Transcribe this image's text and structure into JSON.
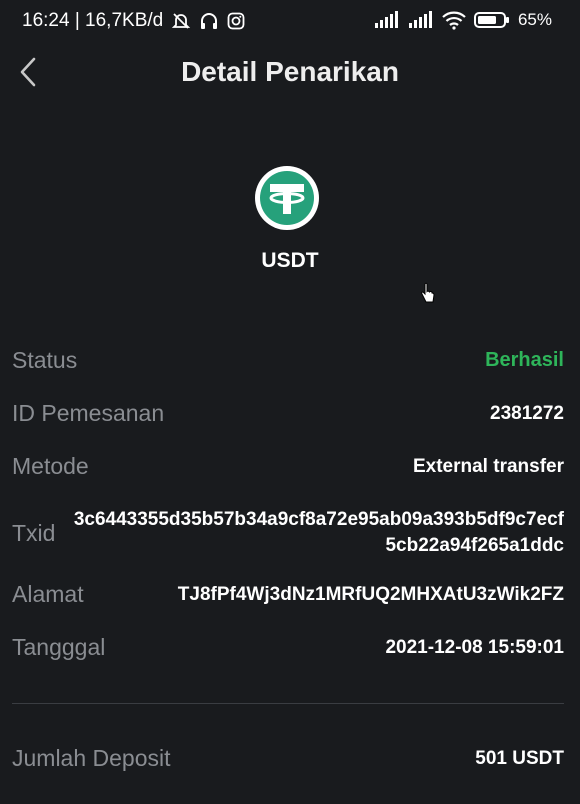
{
  "status_bar": {
    "time_info": "16:24 | 16,7KB/d",
    "battery_percent": "65%"
  },
  "header": {
    "title": "Detail Penarikan"
  },
  "coin": {
    "name": "USDT",
    "logo_color": "#26a17b"
  },
  "details": {
    "status": {
      "label": "Status",
      "value": "Berhasil",
      "color": "#2eb55a"
    },
    "order_id": {
      "label": "ID Pemesanan",
      "value": "2381272"
    },
    "method": {
      "label": "Metode",
      "value": "External transfer"
    },
    "txid": {
      "label": "Txid",
      "value": "3c6443355d35b57b34a9cf8a72e95ab09a393b5df9c7ecf5cb22a94f265a1ddc"
    },
    "address": {
      "label": "Alamat",
      "value": "TJ8fPf4Wj3dNz1MRfUQ2MHXAtU3zWik2FZ"
    },
    "date": {
      "label": "Tangggal",
      "value": "2021-12-08 15:59:01"
    }
  },
  "summary": {
    "amount": {
      "label": "Jumlah Deposit",
      "value": "501 USDT"
    }
  }
}
